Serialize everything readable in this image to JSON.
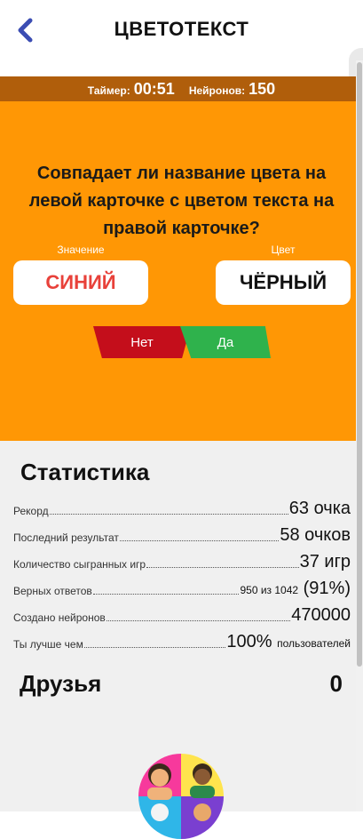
{
  "header": {
    "title": "ЦВЕТОТЕКСТ",
    "back_icon": "chevron-left-icon"
  },
  "topbar": {
    "timer_label": "Таймер:",
    "timer_value": "00:51",
    "neurons_label": "Нейронов:",
    "neurons_value": "150"
  },
  "game": {
    "question": "Совпадает ли название цвета на левой карточке с цветом текста на правой карточке?",
    "left_caption": "Значение",
    "right_caption": "Цвет",
    "left_card": "СИНИЙ",
    "right_card": "ЧЁРНЫЙ",
    "no_button": "Нет",
    "yes_button": "Да"
  },
  "stats": {
    "title": "Статистика",
    "rows": [
      {
        "label": "Рекорд",
        "value": "63 очка",
        "suffix": ""
      },
      {
        "label": "Последний результат",
        "value": "58 очков",
        "suffix": ""
      },
      {
        "label": "Количество сыгранных игр",
        "value": "37 игр",
        "suffix": ""
      },
      {
        "label": "Верных ответов",
        "prefix": "950 из 1042",
        "value": "(91%)",
        "suffix": ""
      },
      {
        "label": "Создано нейронов",
        "value": "470000",
        "suffix": ""
      },
      {
        "label": "Ты лучше чем",
        "value": "100%",
        "suffix": "пользователей"
      }
    ],
    "friends_label": "Друзья",
    "friends_count": "0"
  },
  "colors": {
    "orange": "#ff9705",
    "bar": "#b05e0b",
    "no": "#c40e1b",
    "yes": "#2fb24c",
    "left_card_text": "#e8413a"
  }
}
